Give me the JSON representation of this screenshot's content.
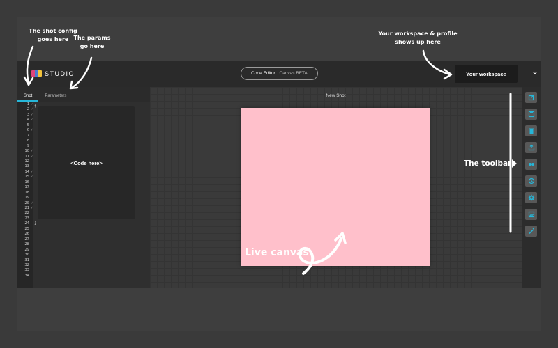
{
  "annotations": {
    "shot_config": "The shot config goes here",
    "params": "The params go here",
    "workspace": "Your workspace & profile shows up here",
    "toolbar": "The toolbar",
    "live_canvas": "Live canvas"
  },
  "header": {
    "logo_text": "STUDIO",
    "mode_active": "Code Editor",
    "mode_inactive": "Canvas BETA",
    "workspace_button": "Your workspace"
  },
  "left_panel": {
    "tabs": [
      {
        "label": "Shot",
        "active": true
      },
      {
        "label": "Parameters",
        "active": false
      }
    ],
    "line_count": 34,
    "fold_lines": [
      1,
      2,
      3,
      4,
      6,
      10,
      11,
      14,
      15,
      20,
      21
    ],
    "open_brace": "{",
    "close_brace": "}",
    "code_placeholder": "<Code here>"
  },
  "canvas": {
    "shot_title": "New Shot",
    "fill_color": "#ffc0cb"
  },
  "toolbar": {
    "icons": [
      "edit-icon",
      "save-icon",
      "trash-icon",
      "share-icon",
      "dots-icon",
      "history-icon",
      "gear-icon",
      "image-icon",
      "magic-wand-icon"
    ],
    "accent_color": "#26b6d8"
  }
}
